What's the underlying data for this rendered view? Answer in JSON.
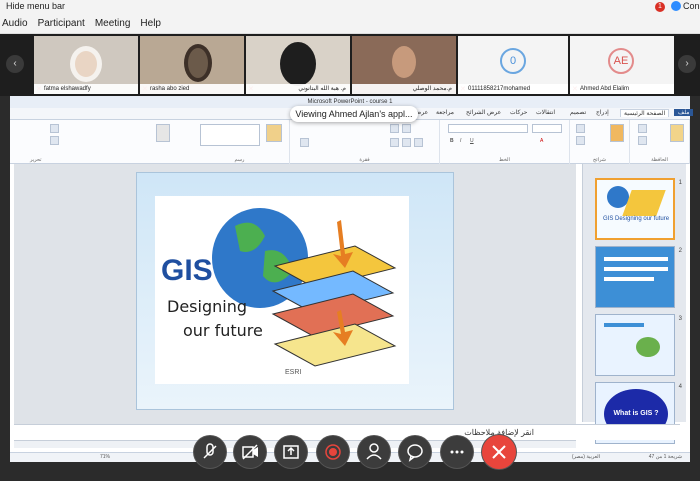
{
  "topbar": {
    "hide_menu": "Hide menu bar",
    "rec": "1",
    "connect": "Con"
  },
  "menu": {
    "items": [
      "Audio",
      "Participant",
      "Meeting",
      "Help"
    ]
  },
  "participants": [
    {
      "name": "fatma elshawadfy"
    },
    {
      "name": "rasha abo zied"
    },
    {
      "name": "م. هبة الله البتانوني"
    },
    {
      "name": "م.محمد الوصلي"
    },
    {
      "name": "01111858217mohamed",
      "avatar": "0"
    },
    {
      "name": "Ahmed Abd Elalim",
      "avatar": "AE"
    }
  ],
  "nav": {
    "prev": "‹",
    "next": "›"
  },
  "ppt": {
    "title": "Microsoft PowerPoint - course 1",
    "tabs": [
      "ملف",
      "الصفحة الرئيسية",
      "إدراج",
      "تصميم",
      "انتقالات",
      "حركات",
      "عرض الشرائح",
      "مراجعة",
      "عرض"
    ],
    "active_tab": "الصفحة الرئيسية",
    "groups": [
      "الحافظة",
      "شرائح",
      "الخط",
      "فقرة",
      "رسم",
      "تحرير"
    ],
    "notes_placeholder": "انقر لإضافة ملاحظات",
    "status_left": "شريحة 1 من 47",
    "status_lang": "العربية (مصر)",
    "zoom": "71%",
    "slide": {
      "logo_gis": "GIS",
      "line1": "Designing",
      "line2": "our future",
      "esri": "ESRI"
    },
    "thumbs": [
      {
        "num": "1",
        "text": "GIS Designing our future"
      },
      {
        "num": "2",
        "text": ""
      },
      {
        "num": "3",
        "text": ""
      },
      {
        "num": "4",
        "text": "What is GIS ?"
      }
    ]
  },
  "toast": "Viewing Ahmed Ajlan's appl...",
  "controls": [
    "mic-off-icon",
    "video-off-icon",
    "share-icon",
    "record-icon",
    "participants-icon",
    "chat-icon",
    "more-icon",
    "end-call-icon"
  ],
  "colors": {
    "end_call": "#e8453c",
    "accent": "#2d8cff",
    "thumb_selected": "#f0a030"
  }
}
